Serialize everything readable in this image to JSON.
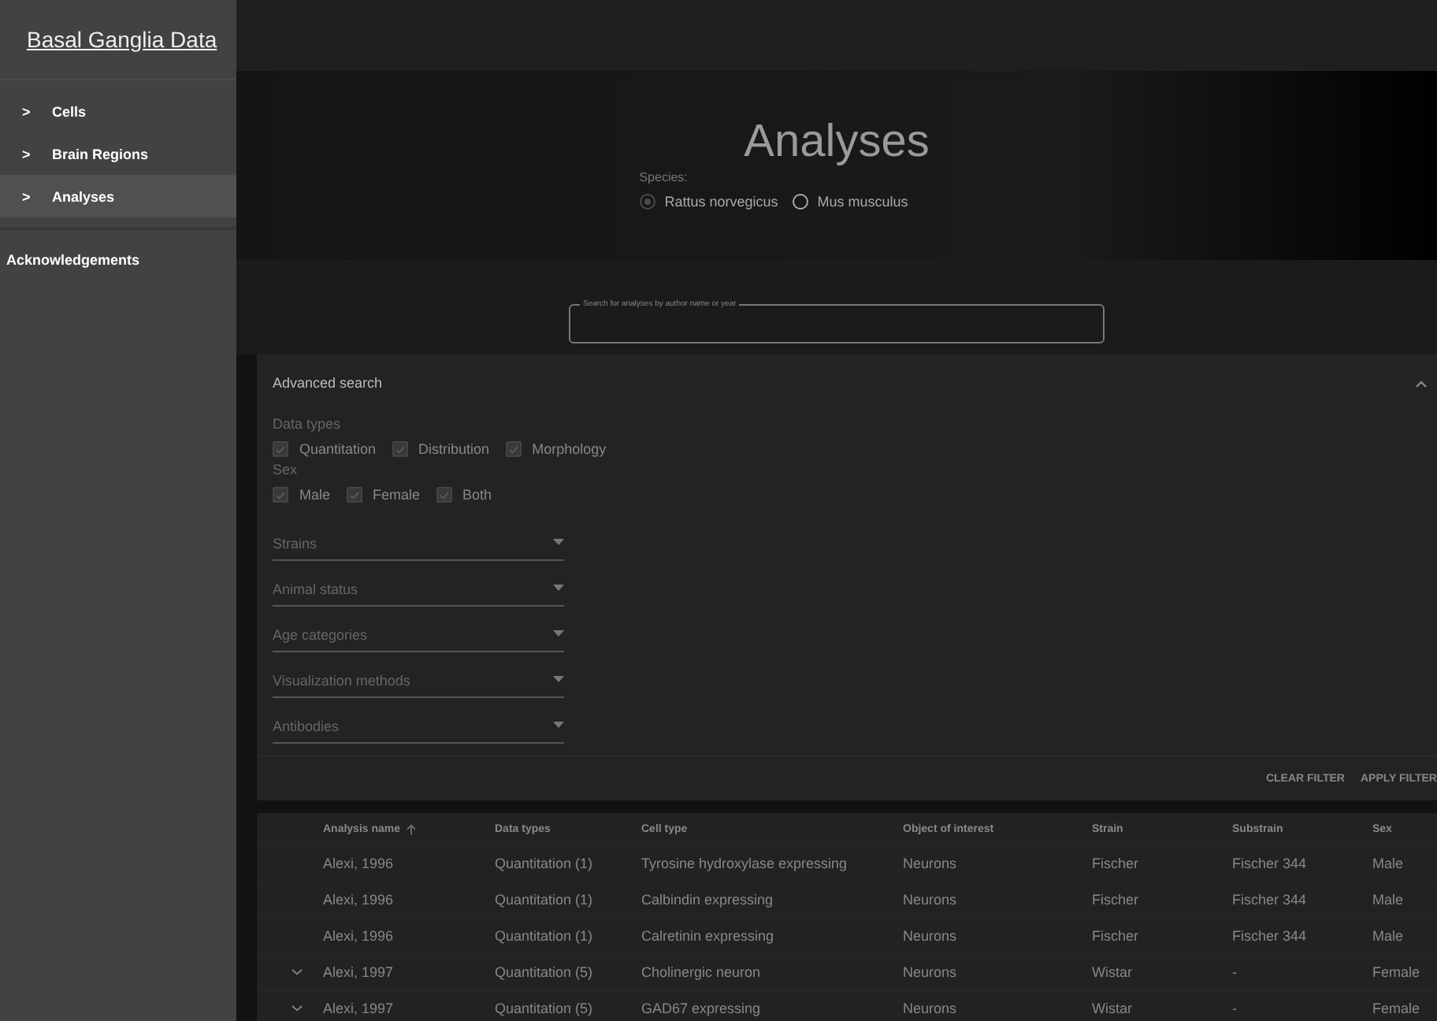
{
  "sidebar": {
    "title": "Basal Ganglia Data",
    "items": [
      {
        "label": "Cells",
        "icon": ">",
        "selected": false
      },
      {
        "label": "Brain Regions",
        "icon": ">",
        "selected": false
      },
      {
        "label": "Analyses",
        "icon": ">",
        "selected": true
      }
    ],
    "footer_link": "Acknowledgements"
  },
  "hero": {
    "title": "Analyses",
    "species_label": "Species:",
    "species": [
      {
        "label": "Rattus norvegicus",
        "selected": true
      },
      {
        "label": "Mus musculus",
        "selected": false
      }
    ]
  },
  "search": {
    "label": "Search for analyses by author name or year"
  },
  "advanced_search": {
    "title": "Advanced search",
    "expanded": true,
    "groups": [
      {
        "label": "Data types",
        "options": [
          {
            "label": "Quantitation",
            "checked": true
          },
          {
            "label": "Distribution",
            "checked": true
          },
          {
            "label": "Morphology",
            "checked": true
          }
        ]
      },
      {
        "label": "Sex",
        "options": [
          {
            "label": "Male",
            "checked": true
          },
          {
            "label": "Female",
            "checked": true
          },
          {
            "label": "Both",
            "checked": true
          }
        ]
      }
    ],
    "selects": [
      {
        "placeholder": "Strains"
      },
      {
        "placeholder": "Animal status"
      },
      {
        "placeholder": "Age categories"
      },
      {
        "placeholder": "Visualization methods"
      },
      {
        "placeholder": "Antibodies"
      }
    ],
    "buttons": [
      "CLEAR FILTER",
      "APPLY FILTER"
    ]
  },
  "table": {
    "columns": [
      {
        "label": "Analysis name",
        "sorted": true
      },
      {
        "label": "Data types",
        "sorted": false
      },
      {
        "label": "Cell type",
        "sorted": false
      },
      {
        "label": "Object of interest",
        "sorted": false
      },
      {
        "label": "Strain",
        "sorted": false
      },
      {
        "label": "Substrain",
        "sorted": false
      },
      {
        "label": "Sex",
        "sorted": false
      }
    ],
    "rows": [
      {
        "expandable": false,
        "cells": [
          "Alexi, 1996",
          "Quantitation (1)",
          "Tyrosine hydroxylase expressing",
          "Neurons",
          "Fischer",
          "Fischer 344",
          "Male"
        ]
      },
      {
        "expandable": false,
        "cells": [
          "Alexi, 1996",
          "Quantitation (1)",
          "Calbindin expressing",
          "Neurons",
          "Fischer",
          "Fischer 344",
          "Male"
        ]
      },
      {
        "expandable": false,
        "cells": [
          "Alexi, 1996",
          "Quantitation (1)",
          "Calretinin expressing",
          "Neurons",
          "Fischer",
          "Fischer 344",
          "Male"
        ]
      },
      {
        "expandable": true,
        "cells": [
          "Alexi, 1997",
          "Quantitation (5)",
          "Cholinergic neuron",
          "Neurons",
          "Wistar",
          "-",
          "Female"
        ]
      },
      {
        "expandable": true,
        "cells": [
          "Alexi, 1997",
          "Quantitation (5)",
          "GAD67 expressing",
          "Neurons",
          "Wistar",
          "-",
          "Female"
        ]
      }
    ]
  }
}
